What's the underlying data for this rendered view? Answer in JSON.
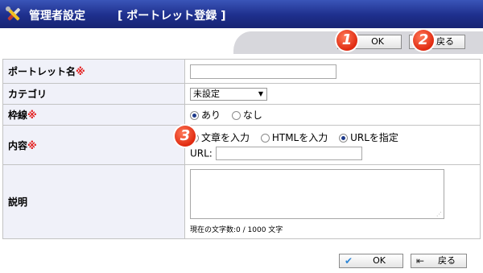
{
  "header": {
    "title": "管理者設定",
    "subtitle": "[ ポートレット登録 ]"
  },
  "top_actions": {
    "ok_label": "OK",
    "back_label": "戻る"
  },
  "bottom_actions": {
    "ok_label": "OK",
    "back_label": "戻る"
  },
  "markers": [
    "1",
    "2",
    "3"
  ],
  "form": {
    "required_mark": "※",
    "portlet_name": {
      "label": "ポートレット名",
      "value": ""
    },
    "category": {
      "label": "カテゴリ",
      "selected": "未設定"
    },
    "border": {
      "label": "枠線",
      "options": [
        "あり",
        "なし"
      ],
      "selected": "あり"
    },
    "content": {
      "label": "内容",
      "options": [
        "文章を入力",
        "HTMLを入力",
        "URLを指定"
      ],
      "selected": "URLを指定",
      "url_label": "URL:",
      "url_value": ""
    },
    "description": {
      "label": "説明",
      "value": "",
      "counter": "現在の文字数:0 / 1000 文字"
    }
  },
  "colors": {
    "title_bar": "#1e2f8c",
    "label_bg": "#f0f1f9",
    "required": "#e32020",
    "marker": "#e02a10",
    "ok_check": "#2f86d6"
  }
}
